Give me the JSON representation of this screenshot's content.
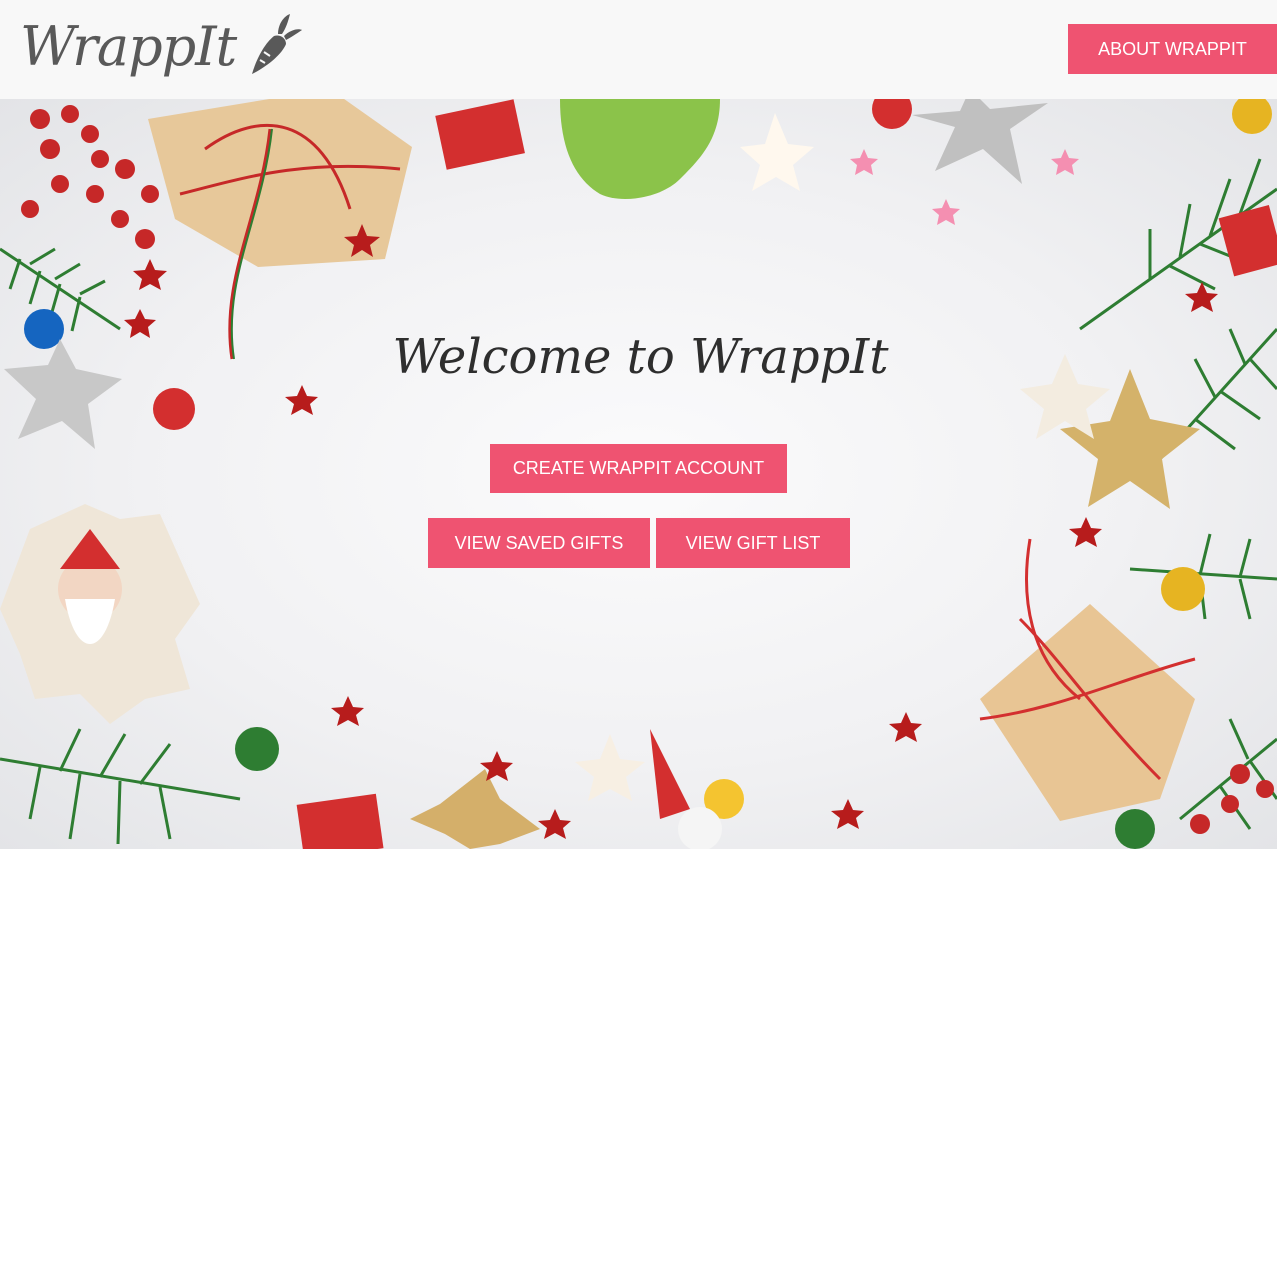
{
  "header": {
    "logo_text": "WrappIt",
    "about_label": "ABOUT WRAPPIT"
  },
  "hero": {
    "title": "Welcome to WrappIt",
    "create_account_label": "CREATE WRAPPIT ACCOUNT",
    "saved_gifts_label": "VIEW SAVED GIFTS",
    "gift_list_label": "VIEW GIFT LIST"
  },
  "colors": {
    "accent": "#ef5371",
    "navbar_bg": "#f8f8f8",
    "logo": "#595959",
    "title": "#2e2e2e"
  },
  "icons": {
    "logo_icon": "carrot-icon"
  },
  "background_image": "christmas-decorations-border"
}
